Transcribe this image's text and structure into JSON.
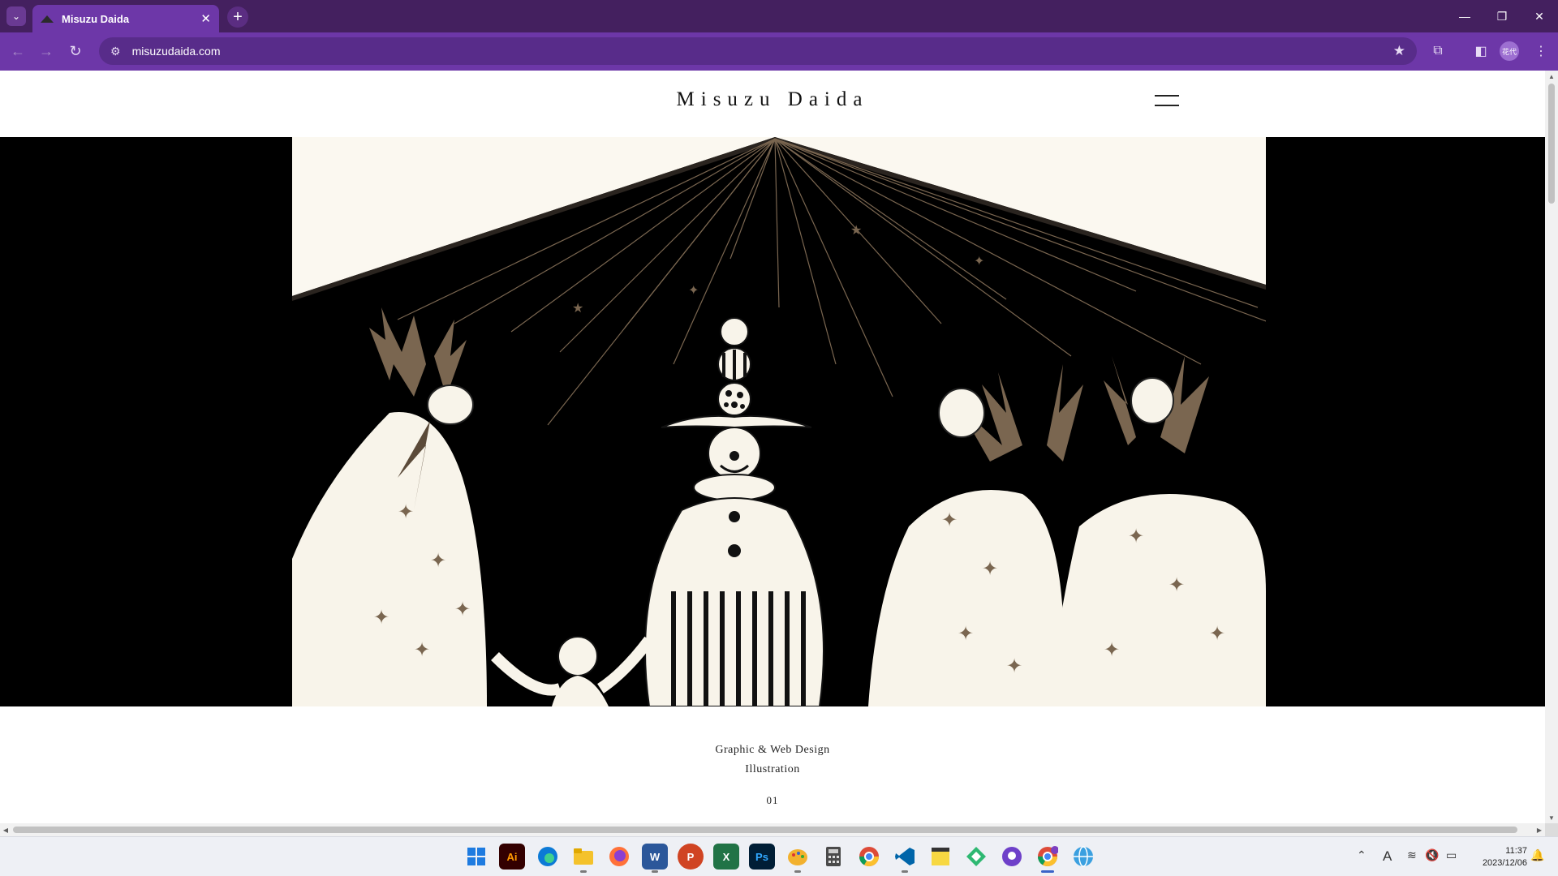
{
  "browser": {
    "tab_title": "Misuzu Daida",
    "tab_close": "✕",
    "new_tab": "+",
    "url": "misuzudaida.com",
    "profile_label": "花代",
    "accent": "#6d37a8",
    "titlebar_color": "#44205f"
  },
  "site": {
    "title": "Misuzu Daida",
    "hero_alt": "Illustration of a clown juggling balls holding hands with a child and tree-headed figures under a circus tent",
    "tagline_line1": "Graphic & Web Design",
    "tagline_line2": "Illustration",
    "slide_counter": "01"
  },
  "taskbar": {
    "apps": [
      {
        "name": "start",
        "icon": "windows-icon"
      },
      {
        "name": "illustrator",
        "label": "Ai",
        "color": "#330000"
      },
      {
        "name": "edge",
        "icon": "edge-icon",
        "color": "#0c7ad6"
      },
      {
        "name": "file-explorer",
        "icon": "folder-icon",
        "color": "#f4c22b"
      },
      {
        "name": "firefox",
        "icon": "firefox-icon",
        "color": "#ff7139"
      },
      {
        "name": "word",
        "label": "W",
        "color": "#2b579a"
      },
      {
        "name": "powerpoint",
        "label": "P",
        "color": "#d04423"
      },
      {
        "name": "excel",
        "label": "X",
        "color": "#217346"
      },
      {
        "name": "photoshop",
        "label": "Ps",
        "color": "#001e36"
      },
      {
        "name": "paint",
        "icon": "palette-icon",
        "color": "#f2b12e"
      },
      {
        "name": "calculator",
        "icon": "calculator-icon",
        "color": "#4a4a4a"
      },
      {
        "name": "chrome",
        "icon": "chrome-icon",
        "color": "#dd4b39"
      },
      {
        "name": "vscode",
        "icon": "vscode-icon",
        "color": "#0065a9"
      },
      {
        "name": "sticky-notes",
        "icon": "note-icon",
        "color": "#f7d842"
      },
      {
        "name": "git-app",
        "icon": "diamond-icon",
        "color": "#2eb872"
      },
      {
        "name": "github-desktop",
        "icon": "github-icon",
        "color": "#6e40c9"
      },
      {
        "name": "chrome-profile",
        "icon": "chrome-icon",
        "color": "#dd4b39"
      },
      {
        "name": "vpn",
        "icon": "globe-icon",
        "color": "#3ba0e0"
      }
    ],
    "ime_indicator": "A",
    "time": "11:37",
    "date": "2023/12/06"
  }
}
